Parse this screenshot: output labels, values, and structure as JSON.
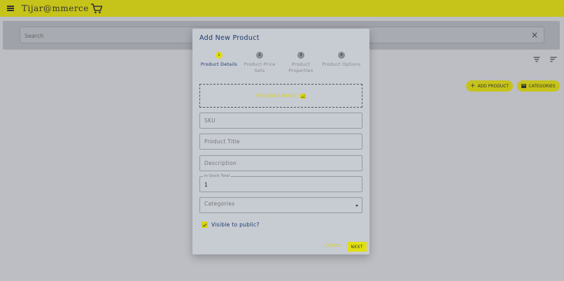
{
  "appbar": {
    "logo": "Tijar@mmerce",
    "color": "#c6c31a"
  },
  "search": {
    "placeholder": "Search",
    "clear_icon": "×"
  },
  "toolbar": {
    "add_product": "ADD PRODUCT",
    "categories": "CATEGORIES"
  },
  "dialog": {
    "title": "Add New Product",
    "steps": [
      {
        "number": "1",
        "label": "Product Details",
        "active": true
      },
      {
        "number": "2",
        "label": "Product Price Sets",
        "active": false
      },
      {
        "number": "3",
        "label": "Product Properties",
        "active": false
      },
      {
        "number": "4",
        "label": "Product Options",
        "active": false
      }
    ],
    "image_label": "PRODUCT IMAGE",
    "fields": {
      "sku": "SKU",
      "title": "Product Title",
      "description": "Description",
      "in_stock_label": "In-Stock Total",
      "in_stock_value": "1",
      "categories": "Categories"
    },
    "visible_label": "Visible to public?",
    "cancel": "CANCEL",
    "next": "NEXT"
  }
}
